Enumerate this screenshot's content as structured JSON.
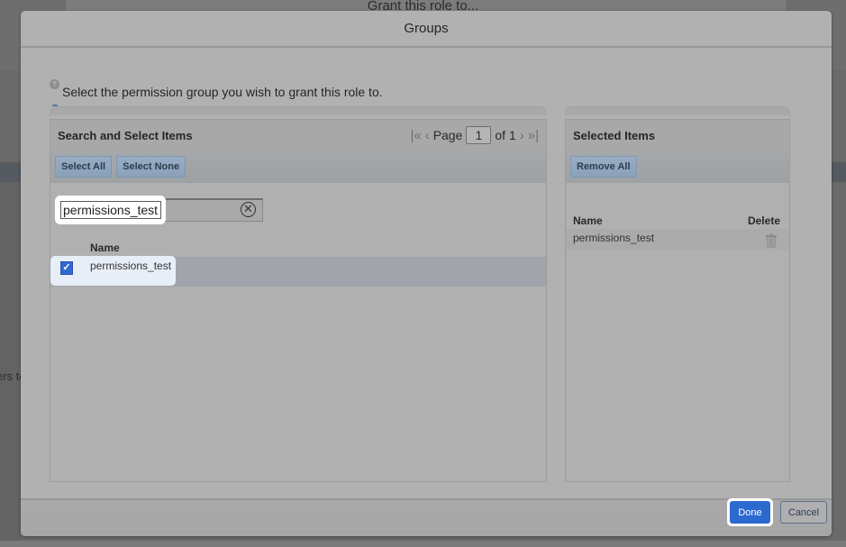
{
  "background": {
    "dialog_title": "Grant this role to...",
    "side_text": "ers to"
  },
  "modal": {
    "title": "Groups",
    "help_text": "Select the permission group you wish to grant this role to."
  },
  "left_panel": {
    "title": "Search and Select Items",
    "toolbar": {
      "select_all_label": "Select All",
      "select_none_label": "Select None"
    },
    "pager": {
      "first_icon": "first-page-icon",
      "prev_icon": "prev-page-icon",
      "page_label": "Page",
      "current_page": "1",
      "of_label": "of 1",
      "next_icon": "next-page-icon",
      "last_icon": "last-page-icon"
    },
    "search": {
      "value": "permissions_test",
      "clear_icon": "clear-icon"
    },
    "list": {
      "column_header": "Name",
      "rows": [
        {
          "label": "permissions_test",
          "checked": true
        }
      ]
    }
  },
  "right_panel": {
    "title": "Selected Items",
    "toolbar": {
      "remove_all_label": "Remove All"
    },
    "list": {
      "columns": [
        "Name",
        "Delete"
      ],
      "rows": [
        {
          "label": "permissions_test",
          "delete_icon": "trash-icon"
        }
      ]
    }
  },
  "footer": {
    "done_label": "Done",
    "cancel_label": "Cancel"
  },
  "colors": {
    "primary": "#2d6ad0",
    "overlay": "#5e5e5e"
  }
}
